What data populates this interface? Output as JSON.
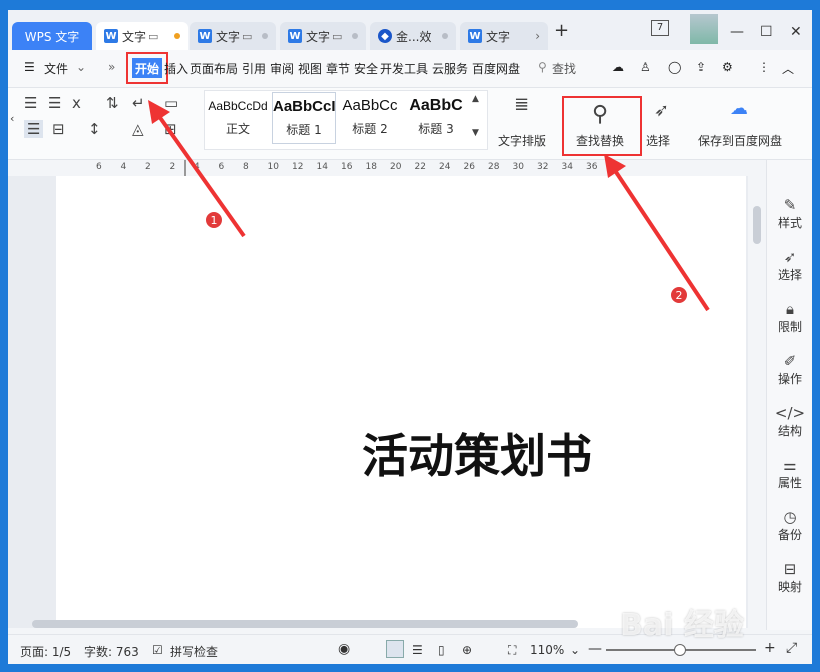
{
  "tabs": {
    "wps": "WPS 文字",
    "doc1": "文字",
    "doc2": "文字",
    "doc3": "文字",
    "doc4": "金...效",
    "doc5": "文字",
    "new_tab": "+",
    "notify_count": "7"
  },
  "menu": {
    "file": "文件",
    "start": "开始",
    "items": [
      "插入",
      "页面布局",
      "引用",
      "审阅",
      "视图",
      "章节",
      "安全",
      "开发工具",
      "云服务",
      "百度网盘"
    ],
    "search_placeholder": "查找"
  },
  "ribbon": {
    "styles": [
      {
        "preview": "AaBbCcDd",
        "name": "正文"
      },
      {
        "preview": "AaBbCcI",
        "name": "标题 1"
      },
      {
        "preview": "AaBbCc",
        "name": "标题 2"
      },
      {
        "preview": "AaBbC",
        "name": "标题 3"
      }
    ],
    "text_layout": "文字排版",
    "find_replace": "查找替换",
    "select": "选择",
    "save_baidu": "保存到百度网盘"
  },
  "ruler": {
    "ticks": [
      "6",
      "4",
      "2",
      "2",
      "4",
      "6",
      "8",
      "10",
      "12",
      "14",
      "16",
      "18",
      "20",
      "22",
      "24",
      "26",
      "28",
      "30",
      "32",
      "34",
      "36"
    ]
  },
  "document": {
    "title": "活动策划书"
  },
  "side_panel": {
    "items": [
      "样式",
      "选择",
      "限制",
      "操作",
      "结构",
      "属性",
      "备份",
      "映射"
    ]
  },
  "status": {
    "page": "页面: 1/5",
    "words": "字数: 763",
    "spellcheck": "拼写检查",
    "zoom": "110%"
  },
  "annotations": {
    "badge1": "1",
    "badge2": "2"
  },
  "watermark": "Bai 经验"
}
